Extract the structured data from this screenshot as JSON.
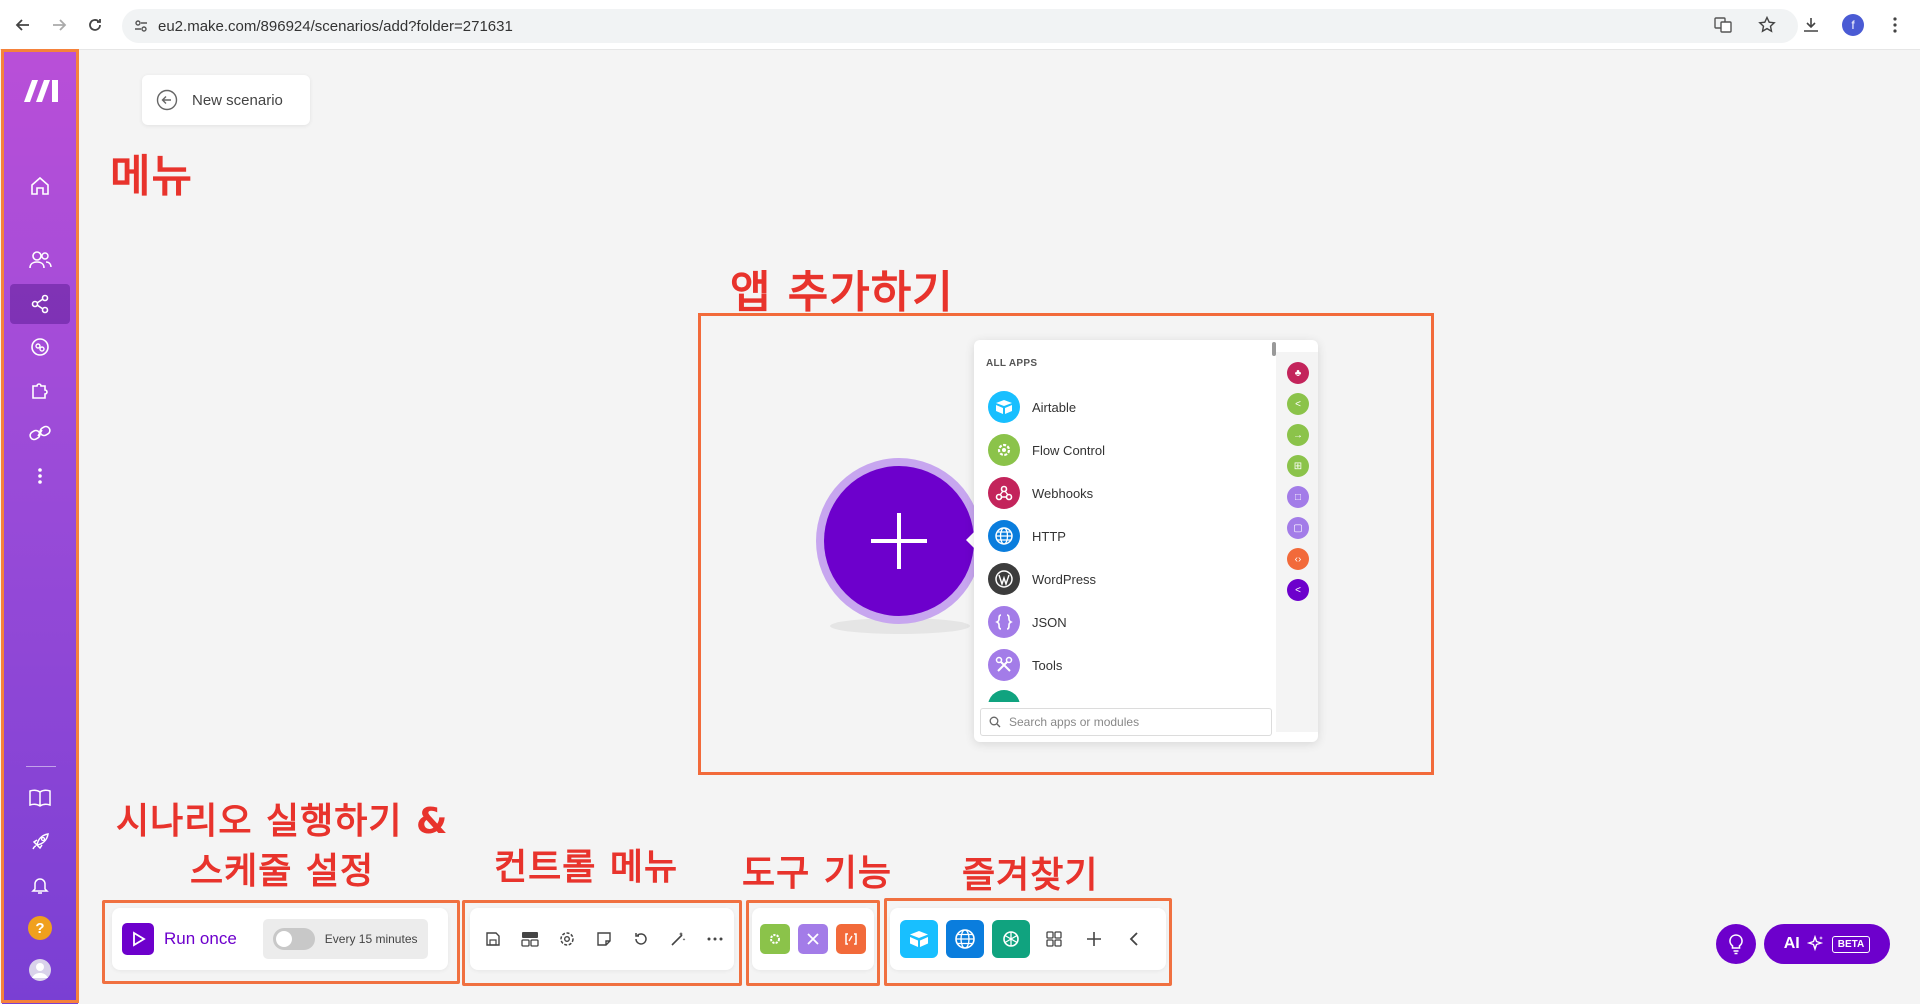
{
  "browser": {
    "url": "eu2.make.com/896924/scenarios/add?folder=271631",
    "profile_initial": "f"
  },
  "sidebar": {
    "items": [
      {
        "name": "home-icon"
      },
      {
        "name": "team-icon"
      },
      {
        "name": "scenarios-icon",
        "active": true
      },
      {
        "name": "connections-icon"
      },
      {
        "name": "apps-icon"
      },
      {
        "name": "link-icon"
      },
      {
        "name": "more-icon"
      }
    ],
    "bottom": [
      {
        "name": "book-icon"
      },
      {
        "name": "rocket-icon"
      },
      {
        "name": "bell-icon"
      },
      {
        "name": "help-icon",
        "label": "?"
      },
      {
        "name": "user-avatar"
      }
    ]
  },
  "header": {
    "new_scenario_label": "New scenario"
  },
  "annotations": {
    "menu": "메뉴",
    "add_app": "앱 추가하기",
    "run_line1": "시나리오 실행하기 &",
    "run_line2": "스케줄 설정",
    "control_menu": "컨트롤 메뉴",
    "tools": "도구 기능",
    "favorites": "즐겨찾기"
  },
  "apps_popup": {
    "header": "ALL APPS",
    "apps": [
      {
        "name": "Airtable",
        "color": "#18bfff",
        "icon": "airtable-icon"
      },
      {
        "name": "Flow Control",
        "color": "#8bc34a",
        "icon": "gear-icon"
      },
      {
        "name": "Webhooks",
        "color": "#c3245b",
        "icon": "webhook-icon"
      },
      {
        "name": "HTTP",
        "color": "#0a7ddd",
        "icon": "globe-icon"
      },
      {
        "name": "WordPress",
        "color": "#3c3c3c",
        "icon": "wordpress-icon"
      },
      {
        "name": "JSON",
        "color": "#a37ce8",
        "icon": "braces-icon"
      },
      {
        "name": "Tools",
        "color": "#a37ce8",
        "icon": "tools-icon"
      }
    ],
    "rail_colors": [
      "#c3245b",
      "#8bc34a",
      "#8bc34a",
      "#8bc34a",
      "#a37ce8",
      "#a37ce8",
      "#f26a3a",
      "#6d00cc"
    ],
    "search_placeholder": "Search apps or modules"
  },
  "run_panel": {
    "run_label": "Run once",
    "schedule_label": "Every 15 minutes"
  },
  "control_menu": {
    "items": [
      "save-icon",
      "layout-icon",
      "settings-icon",
      "notes-icon",
      "undo-icon",
      "magic-wand-icon",
      "ellipsis-icon"
    ]
  },
  "tools": {
    "items": [
      {
        "name": "flow-control-tool-icon",
        "color": "#8bc34a"
      },
      {
        "name": "tools-tool-icon",
        "color": "#a37ce8"
      },
      {
        "name": "text-parser-tool-icon",
        "color": "#f26a3a"
      }
    ]
  },
  "favorites": {
    "items": [
      {
        "name": "airtable-fav-icon",
        "color": "#18bfff"
      },
      {
        "name": "http-fav-icon",
        "color": "#0a7ddd"
      },
      {
        "name": "openai-fav-icon",
        "color": "#10a37f"
      }
    ]
  },
  "ai_button": {
    "label": "AI",
    "beta": "BETA"
  }
}
